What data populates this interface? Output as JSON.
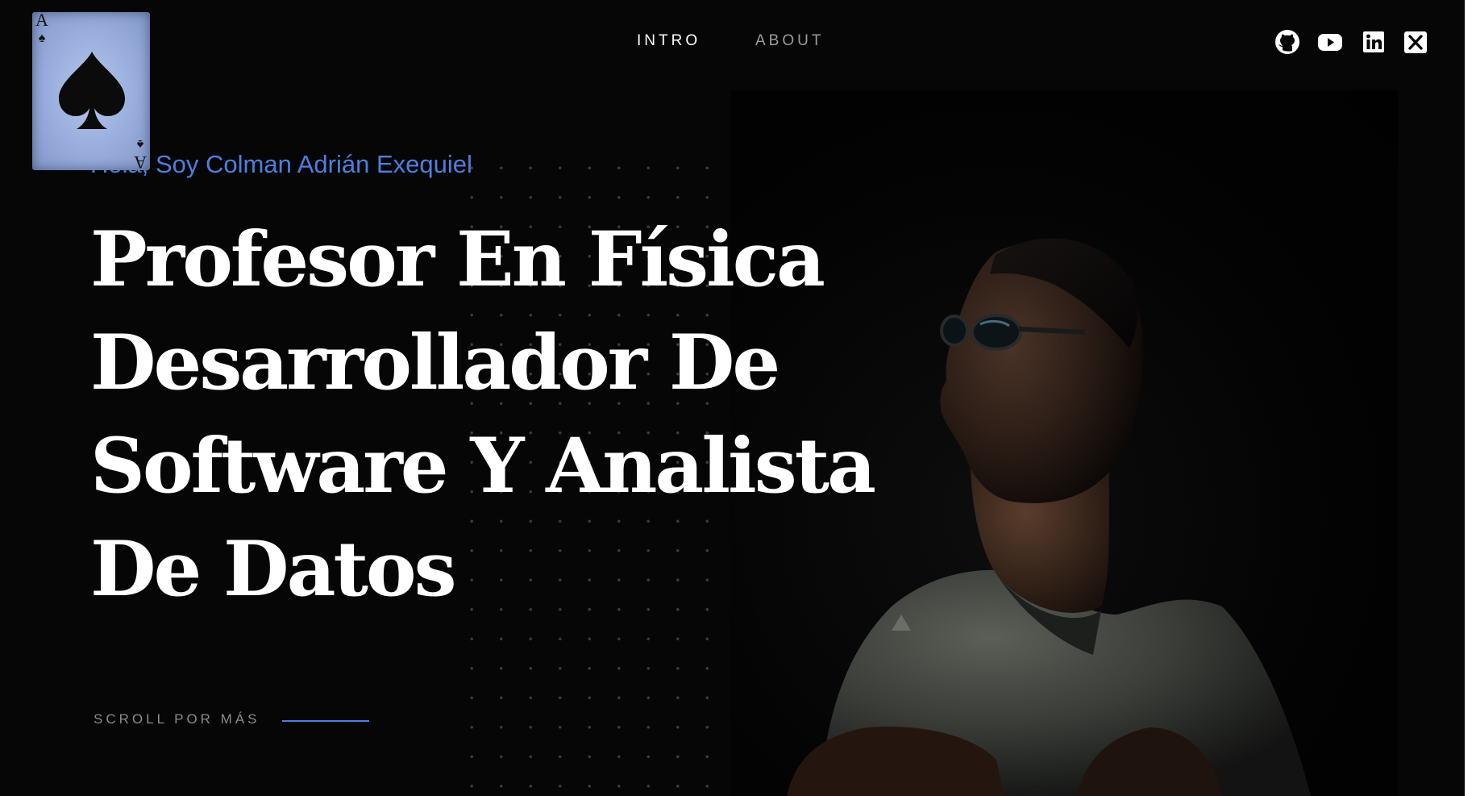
{
  "nav": {
    "links": [
      {
        "label": "INTRO"
      },
      {
        "label": "ABOUT"
      }
    ]
  },
  "socials": [
    {
      "icon": "github-icon"
    },
    {
      "icon": "youtube-icon"
    },
    {
      "icon": "linkedin-icon"
    },
    {
      "icon": "x-icon"
    }
  ],
  "card": {
    "rank": "A",
    "suit_icon": "spade-icon"
  },
  "hero": {
    "greeting": "Hola, Soy Colman Adrián Exequiel",
    "headline_lines": [
      "Profesor En Física",
      "Desarrollador De",
      "Software Y Analista",
      "De Datos"
    ],
    "scroll_label": "SCROLL POR MÁS"
  },
  "colors": {
    "background": "#060607",
    "accent": "#4d7fdc",
    "text": "#ffffff",
    "muted": "#9a9a9f"
  }
}
